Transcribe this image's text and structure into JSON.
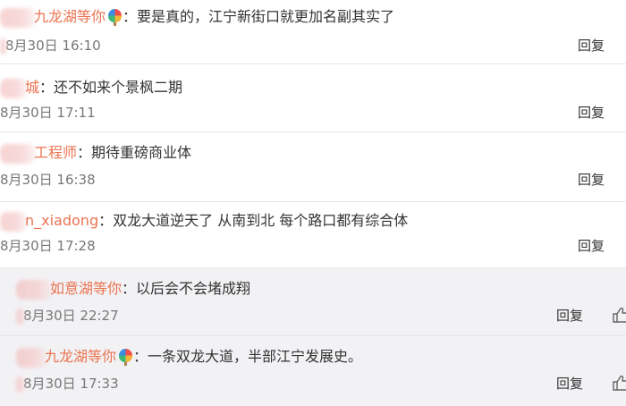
{
  "comments": [
    {
      "username": "九龙湖等你",
      "has_badge": true,
      "text": "：要是真的，江宁新街口就更加名副其实了",
      "time": "8月30日 16:10",
      "reply": "回复"
    },
    {
      "username": "城",
      "has_badge": false,
      "text": "：还不如来个景枫二期",
      "time": "8月30日 17:11",
      "reply": "回复"
    },
    {
      "username": "工程师",
      "has_badge": false,
      "text": "：期待重磅商业体",
      "time": "8月30日 16:38",
      "reply": "回复"
    },
    {
      "username": "n_xiadong",
      "has_badge": false,
      "text": "：双龙大道逆天了 从南到北 每个路口都有综合体",
      "time": "8月30日 17:28",
      "reply": "回复"
    },
    {
      "username": "如意湖等你",
      "has_badge": false,
      "text": "：以后会不会堵成翔",
      "time": "8月30日 22:27",
      "reply": "回复"
    },
    {
      "username": "九龙湖等你",
      "has_badge": true,
      "text": "：一条双龙大道，半部江宁发展史。",
      "time": "8月30日 17:33",
      "reply": "回复"
    }
  ],
  "icons": {
    "badge": "hot-air-balloon-icon",
    "like": "thumbs-up-icon"
  },
  "colors": {
    "username": "#eb7350",
    "text": "#333333",
    "nested_background": "#f2f2f5",
    "separator": "#e6e6e6"
  }
}
